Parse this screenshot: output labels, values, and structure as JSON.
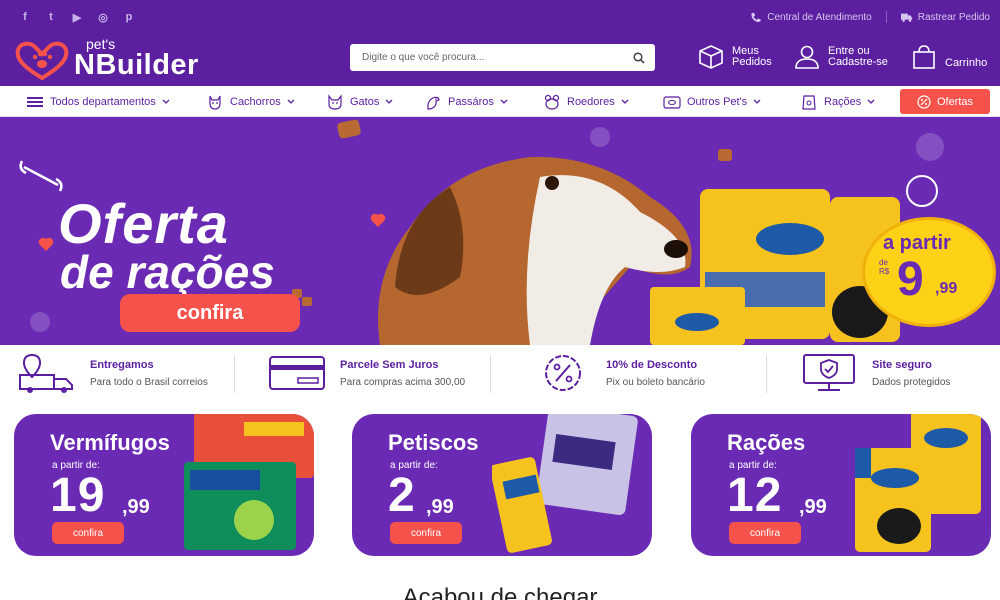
{
  "topbar": {
    "socials": [
      {
        "icon": "facebook-icon",
        "glyph": "f"
      },
      {
        "icon": "twitter-icon",
        "glyph": "t"
      },
      {
        "icon": "youtube-icon",
        "glyph": "▶"
      },
      {
        "icon": "instagram-icon",
        "glyph": "◎"
      },
      {
        "icon": "pinterest-icon",
        "glyph": "p"
      }
    ],
    "service_center": "Central de Atendimento",
    "track_order": "Rastrear Pedido"
  },
  "header": {
    "logo_small": "pet's",
    "logo_big": "NBuilder",
    "search_placeholder": "Digite o que você procura...",
    "my_orders_line1": "Meus",
    "my_orders_line2": "Pedidos",
    "login_line1": "Entre ou",
    "login_line2": "Cadastre-se",
    "cart": "Carrinho"
  },
  "nav": {
    "items": [
      {
        "label": "Todos departamentos",
        "icon": "menu-icon"
      },
      {
        "label": "Cachorros",
        "icon": "dog-icon"
      },
      {
        "label": "Gatos",
        "icon": "cat-icon"
      },
      {
        "label": "Passáros",
        "icon": "bird-icon"
      },
      {
        "label": "Roedores",
        "icon": "rodent-icon"
      },
      {
        "label": "Outros Pet's",
        "icon": "fish-icon"
      },
      {
        "label": "Rações",
        "icon": "food-bag-icon"
      }
    ],
    "offers": "Ofertas"
  },
  "banner": {
    "title_line1": "Oferta",
    "title_line2": "de rações",
    "cta": "confira",
    "badge_top": "a partir",
    "badge_de": "de",
    "badge_currency": "R$",
    "badge_price": "9",
    "badge_cents": ",99"
  },
  "features": [
    {
      "title": "Entregamos",
      "subtitle": "Para todo o Brasil correios",
      "icon": "delivery-truck-icon"
    },
    {
      "title": "Parcele Sem Juros",
      "subtitle": "Para compras acima 300,00",
      "icon": "credit-card-icon"
    },
    {
      "title": "10% de Desconto",
      "subtitle": "Pix ou boleto bancário",
      "icon": "discount-badge-icon"
    },
    {
      "title": "Site seguro",
      "subtitle": "Dados protegidos",
      "icon": "secure-monitor-icon"
    }
  ],
  "cards": [
    {
      "title": "Vermífugos",
      "from": "a partir de:",
      "price": "19",
      "cents": ",99",
      "button": "confira"
    },
    {
      "title": "Petiscos",
      "from": "a partir de:",
      "price": "2",
      "cents": ",99",
      "button": "confira"
    },
    {
      "title": "Rações",
      "from": "a partir de:",
      "price": "12",
      "cents": ",99",
      "button": "confira"
    }
  ],
  "section_heading": "Acabou de chegar",
  "colors": {
    "primary": "#5b1fa0",
    "banner": "#6a2ab4",
    "accent": "#f4524b",
    "badge": "#fcd116"
  }
}
